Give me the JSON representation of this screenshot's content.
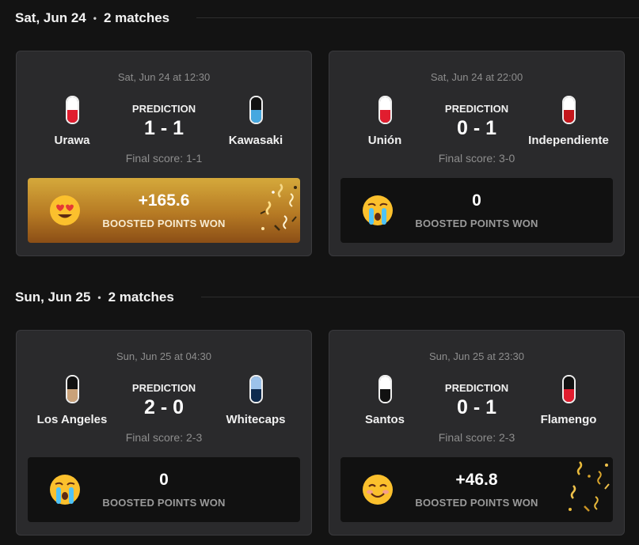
{
  "days": [
    {
      "date": "Sat, Jun 24",
      "separator": "•",
      "count": "2 matches",
      "matches": [
        {
          "datetime": "Sat, Jun 24 at 12:30",
          "home": {
            "name": "Urawa",
            "kit": [
              "#ffffff",
              "#e11d2f"
            ]
          },
          "away": {
            "name": "Kawasaki",
            "kit": [
              "#111111",
              "#46a8e0"
            ]
          },
          "prediction_label": "PREDICTION",
          "prediction": "1 - 1",
          "final_score": "Final score: 1-1",
          "points": "+165.6",
          "points_label": "BOOSTED POINTS WON",
          "emoji": "heart-eyes-emoji",
          "won": true
        },
        {
          "datetime": "Sat, Jun 24 at 22:00",
          "home": {
            "name": "Unión",
            "kit": [
              "#ffffff",
              "#e11d2f"
            ]
          },
          "away": {
            "name": "Independiente",
            "kit": [
              "#ffffff",
              "#c4161c"
            ]
          },
          "prediction_label": "PREDICTION",
          "prediction": "0 - 1",
          "final_score": "Final score: 3-0",
          "points": "0",
          "points_label": "BOOSTED POINTS WON",
          "emoji": "crying-emoji",
          "won": false
        }
      ]
    },
    {
      "date": "Sun, Jun 25",
      "separator": "•",
      "count": "2 matches",
      "matches": [
        {
          "datetime": "Sun, Jun 25 at 04:30",
          "home": {
            "name": "Los Angeles",
            "kit": [
              "#111111",
              "#c9a27a"
            ]
          },
          "away": {
            "name": "Whitecaps",
            "kit": [
              "#9cc2ea",
              "#0e2a4d"
            ]
          },
          "prediction_label": "PREDICTION",
          "prediction": "2 - 0",
          "final_score": "Final score: 2-3",
          "points": "0",
          "points_label": "BOOSTED POINTS WON",
          "emoji": "crying-emoji",
          "won": false
        },
        {
          "datetime": "Sun, Jun 25 at 23:30",
          "home": {
            "name": "Santos",
            "kit": [
              "#ffffff",
              "#111111"
            ]
          },
          "away": {
            "name": "Flamengo",
            "kit": [
              "#111111",
              "#e11d2f"
            ]
          },
          "prediction_label": "PREDICTION",
          "prediction": "0 - 1",
          "final_score": "Final score: 2-3",
          "points": "+46.8",
          "points_label": "BOOSTED POINTS WON",
          "emoji": "smiling-emoji",
          "won": true
        }
      ]
    }
  ]
}
